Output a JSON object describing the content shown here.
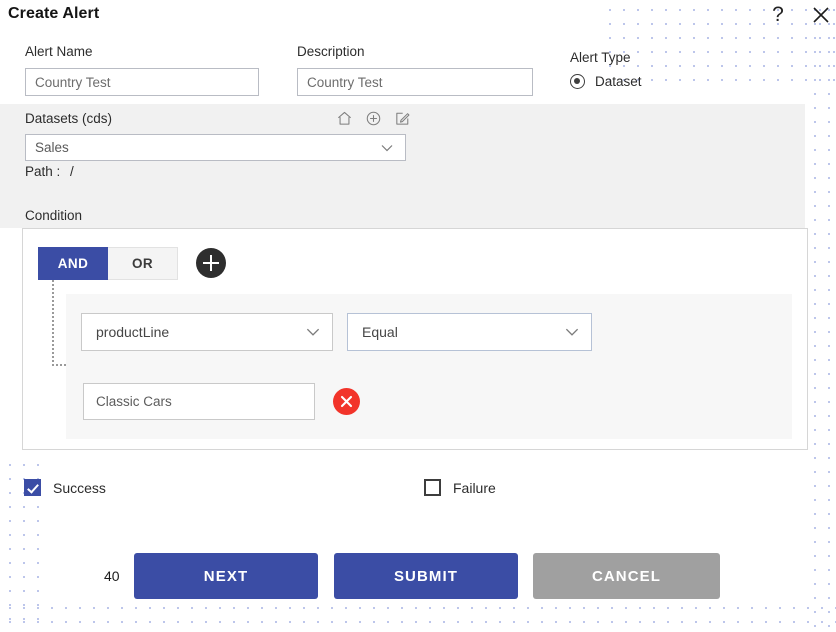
{
  "dialog": {
    "title": "Create Alert",
    "help_icon": "question-mark-icon",
    "close_icon": "close-icon"
  },
  "form": {
    "alert_name": {
      "label": "Alert Name",
      "value": "Country Test",
      "placeholder": "Country Test"
    },
    "description": {
      "label": "Description",
      "value": "Country Test",
      "placeholder": "Country Test"
    },
    "alert_type": {
      "label": "Alert Type",
      "selected": "Dataset",
      "options": [
        "Dataset"
      ]
    }
  },
  "datasets": {
    "label": "Datasets (cds)",
    "selected": "Sales",
    "path_label": "Path :",
    "path_value": "/",
    "icons": [
      "home-icon",
      "plus-circle-icon",
      "edit-square-icon"
    ]
  },
  "condition": {
    "label": "Condition",
    "logic": {
      "and_label": "AND",
      "or_label": "OR",
      "active": "AND"
    },
    "add_button": "add-condition-icon",
    "rows": [
      {
        "field": "productLine",
        "operator": "Equal",
        "value": "Classic Cars",
        "remove_icon": "remove-condition-icon"
      }
    ]
  },
  "notifications": {
    "success": {
      "label": "Success",
      "checked": true
    },
    "failure": {
      "label": "Failure",
      "checked": false
    }
  },
  "footer": {
    "step_counter": "40",
    "next_label": "NEXT",
    "submit_label": "SUBMIT",
    "cancel_label": "CANCEL"
  },
  "colors": {
    "primary_blue": "#3b4da5",
    "cancel_gray": "#a0a0a0",
    "danger_red": "#f2342a",
    "panel_gray": "#f1f1f1",
    "group_gray": "#f7f7f7",
    "dot_blue": "#9aa7e0"
  }
}
